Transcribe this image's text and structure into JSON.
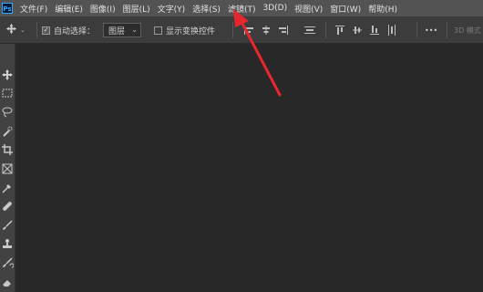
{
  "app": {
    "logo_text": "Ps"
  },
  "menu": [
    {
      "label": "文件(F)"
    },
    {
      "label": "编辑(E)"
    },
    {
      "label": "图像(I)"
    },
    {
      "label": "图层(L)"
    },
    {
      "label": "文字(Y)"
    },
    {
      "label": "选择(S)"
    },
    {
      "label": "滤镜(T)"
    },
    {
      "label": "3D(D)"
    },
    {
      "label": "视图(V)"
    },
    {
      "label": "窗口(W)"
    },
    {
      "label": "帮助(H)"
    }
  ],
  "options": {
    "tool_icon": "move-icon",
    "auto_select_label": "自动选择：",
    "auto_select_checked": true,
    "auto_select_target": "图层",
    "transform_controls_label": "显示变换控件",
    "transform_controls_checked": false,
    "more_label": "•••",
    "three_d_mode_label": "3D 模式"
  },
  "toolbar": {
    "tools": [
      "move-tool-icon",
      "marquee-tool-icon",
      "lasso-tool-icon",
      "quick-selection-tool-icon",
      "crop-tool-icon",
      "frame-tool-icon",
      "eyedropper-tool-icon",
      "healing-brush-tool-icon",
      "brush-tool-icon",
      "clone-stamp-tool-icon",
      "history-brush-tool-icon",
      "eraser-tool-icon"
    ]
  },
  "annotation": {
    "color": "#e8262d"
  }
}
